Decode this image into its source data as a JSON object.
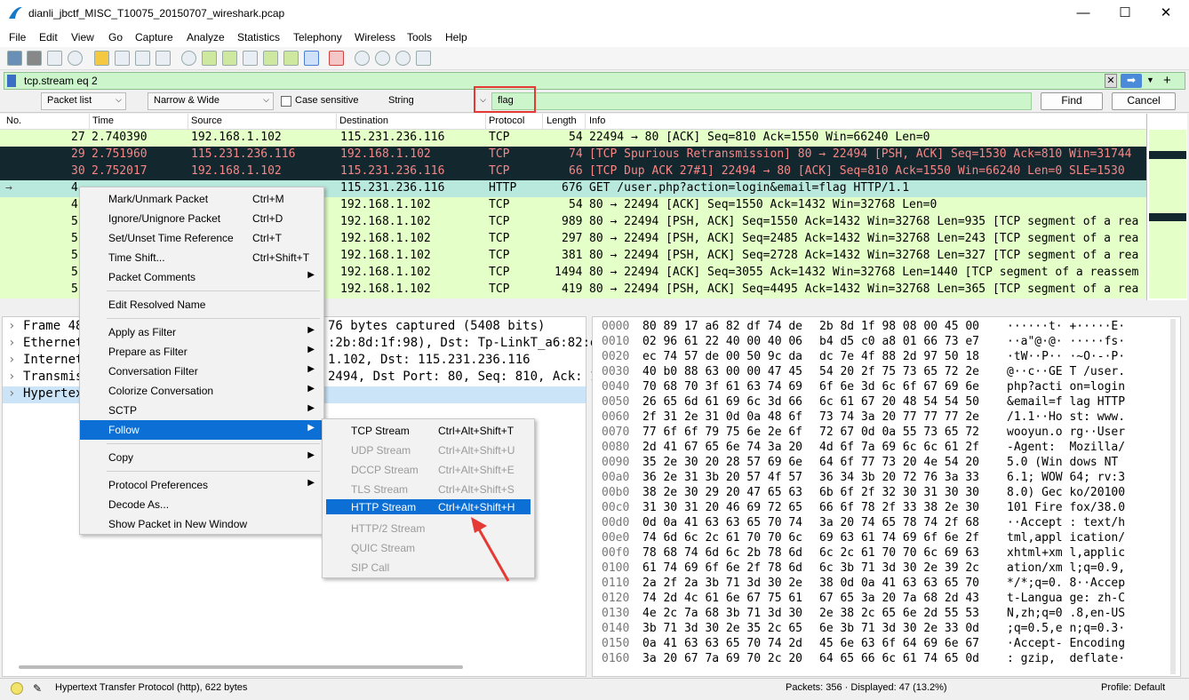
{
  "window": {
    "title": "dianli_jbctf_MISC_T10075_20150707_wireshark.pcap",
    "minimize": "—",
    "maximize": "☐",
    "close": "✕"
  },
  "menubar": [
    "File",
    "Edit",
    "View",
    "Go",
    "Capture",
    "Analyze",
    "Statistics",
    "Telephony",
    "Wireless",
    "Tools",
    "Help"
  ],
  "filter": {
    "value": "tcp.stream eq 2"
  },
  "findbar": {
    "scope": "Packet list",
    "charset": "Narrow & Wide",
    "case_label": "Case sensitive",
    "type": "String",
    "query": "flag",
    "find_label": "Find",
    "cancel_label": "Cancel"
  },
  "columns": [
    "No.",
    "Time",
    "Source",
    "Destination",
    "Protocol",
    "Length",
    "Info"
  ],
  "packets": [
    {
      "no": "27",
      "time": "2.740390",
      "src": "192.168.1.102",
      "dst": "115.231.236.116",
      "proto": "TCP",
      "len": "54",
      "info": "22494 → 80 [ACK] Seq=810 Ack=1550 Win=66240 Len=0"
    },
    {
      "no": "29",
      "time": "2.751960",
      "src": "115.231.236.116",
      "dst": "192.168.1.102",
      "proto": "TCP",
      "len": "74",
      "info": "[TCP Spurious Retransmission] 80 → 22494 [PSH, ACK] Seq=1530 Ack=810 Win=31744"
    },
    {
      "no": "30",
      "time": "2.752017",
      "src": "192.168.1.102",
      "dst": "115.231.236.116",
      "proto": "TCP",
      "len": "66",
      "info": "[TCP Dup ACK 27#1] 22494 → 80 [ACK] Seq=810 Ack=1550 Win=66240 Len=0 SLE=1530"
    },
    {
      "no": "4",
      "time": "",
      "src": "",
      "dst": "115.231.236.116",
      "proto": "HTTP",
      "len": "676",
      "info": "GET /user.php?action=login&email=flag HTTP/1.1"
    },
    {
      "no": "4",
      "time": "",
      "src": "",
      "dst": "192.168.1.102",
      "proto": "TCP",
      "len": "54",
      "info": "80 → 22494 [ACK] Seq=1550 Ack=1432 Win=32768 Len=0"
    },
    {
      "no": "5",
      "time": "",
      "src": "",
      "dst": "192.168.1.102",
      "proto": "TCP",
      "len": "989",
      "info": "80 → 22494 [PSH, ACK] Seq=1550 Ack=1432 Win=32768 Len=935 [TCP segment of a rea"
    },
    {
      "no": "5",
      "time": "",
      "src": "",
      "dst": "192.168.1.102",
      "proto": "TCP",
      "len": "297",
      "info": "80 → 22494 [PSH, ACK] Seq=2485 Ack=1432 Win=32768 Len=243 [TCP segment of a rea"
    },
    {
      "no": "5",
      "time": "",
      "src": "",
      "dst": "192.168.1.102",
      "proto": "TCP",
      "len": "381",
      "info": "80 → 22494 [PSH, ACK] Seq=2728 Ack=1432 Win=32768 Len=327 [TCP segment of a rea"
    },
    {
      "no": "5",
      "time": "",
      "src": "",
      "dst": "192.168.1.102",
      "proto": "TCP",
      "len": "1494",
      "info": "80 → 22494 [ACK] Seq=3055 Ack=1432 Win=32768 Len=1440 [TCP segment of a reassem"
    },
    {
      "no": "5",
      "time": "",
      "src": "",
      "dst": "192.168.1.102",
      "proto": "TCP",
      "len": "419",
      "info": "80 → 22494 [PSH, ACK] Seq=4495 Ack=1432 Win=32768 Len=365 [TCP segment of a rea"
    }
  ],
  "details": [
    {
      "head": "Frame 48",
      "tail": "76 bytes captured (5408 bits)"
    },
    {
      "head": "Ethernet",
      "tail": ":2b:8d:1f:98), Dst: Tp-LinkT_a6:82:df"
    },
    {
      "head": "Internet",
      "tail": "1.102, Dst: 115.231.236.116"
    },
    {
      "head": "Transmis",
      "tail": "2494, Dst Port: 80, Seq: 810, Ack: 15"
    },
    {
      "head": "Hypertex",
      "tail": ""
    }
  ],
  "hex": [
    {
      "off": "0000",
      "a": "80 89 17 a6 82 df 74 de",
      "b": "2b 8d 1f 98 08 00 45 00",
      "ascii": "······t· +·····E·"
    },
    {
      "off": "0010",
      "a": "02 96 61 22 40 00 40 06",
      "b": "b4 d5 c0 a8 01 66 73 e7",
      "ascii": "··a\"@·@· ·····fs·"
    },
    {
      "off": "0020",
      "a": "ec 74 57 de 00 50 9c da",
      "b": "dc 7e 4f 88 2d 97 50 18",
      "ascii": "·tW··P·· ·~O·-·P·"
    },
    {
      "off": "0030",
      "a": "40 b0 88 63 00 00 47 45",
      "b": "54 20 2f 75 73 65 72 2e",
      "ascii": "@··c··GE T /user."
    },
    {
      "off": "0040",
      "a": "70 68 70 3f 61 63 74 69",
      "b": "6f 6e 3d 6c 6f 67 69 6e",
      "ascii": "php?acti on=login"
    },
    {
      "off": "0050",
      "a": "26 65 6d 61 69 6c 3d 66",
      "b": "6c 61 67 20 48 54 54 50",
      "ascii": "&email=f lag HTTP"
    },
    {
      "off": "0060",
      "a": "2f 31 2e 31 0d 0a 48 6f",
      "b": "73 74 3a 20 77 77 77 2e",
      "ascii": "/1.1··Ho st: www."
    },
    {
      "off": "0070",
      "a": "77 6f 6f 79 75 6e 2e 6f",
      "b": "72 67 0d 0a 55 73 65 72",
      "ascii": "wooyun.o rg··User"
    },
    {
      "off": "0080",
      "a": "2d 41 67 65 6e 74 3a 20",
      "b": "4d 6f 7a 69 6c 6c 61 2f",
      "ascii": "-Agent:  Mozilla/"
    },
    {
      "off": "0090",
      "a": "35 2e 30 20 28 57 69 6e",
      "b": "64 6f 77 73 20 4e 54 20",
      "ascii": "5.0 (Win dows NT "
    },
    {
      "off": "00a0",
      "a": "36 2e 31 3b 20 57 4f 57",
      "b": "36 34 3b 20 72 76 3a 33",
      "ascii": "6.1; WOW 64; rv:3"
    },
    {
      "off": "00b0",
      "a": "38 2e 30 29 20 47 65 63",
      "b": "6b 6f 2f 32 30 31 30 30",
      "ascii": "8.0) Gec ko/20100"
    },
    {
      "off": "00c0",
      "a": "31 30 31 20 46 69 72 65",
      "b": "66 6f 78 2f 33 38 2e 30",
      "ascii": "101 Fire fox/38.0"
    },
    {
      "off": "00d0",
      "a": "0d 0a 41 63 63 65 70 74",
      "b": "3a 20 74 65 78 74 2f 68",
      "ascii": "··Accept : text/h"
    },
    {
      "off": "00e0",
      "a": "74 6d 6c 2c 61 70 70 6c",
      "b": "69 63 61 74 69 6f 6e 2f",
      "ascii": "tml,appl ication/"
    },
    {
      "off": "00f0",
      "a": "78 68 74 6d 6c 2b 78 6d",
      "b": "6c 2c 61 70 70 6c 69 63",
      "ascii": "xhtml+xm l,applic"
    },
    {
      "off": "0100",
      "a": "61 74 69 6f 6e 2f 78 6d",
      "b": "6c 3b 71 3d 30 2e 39 2c",
      "ascii": "ation/xm l;q=0.9,"
    },
    {
      "off": "0110",
      "a": "2a 2f 2a 3b 71 3d 30 2e",
      "b": "38 0d 0a 41 63 63 65 70",
      "ascii": "*/*;q=0. 8··Accep"
    },
    {
      "off": "0120",
      "a": "74 2d 4c 61 6e 67 75 61",
      "b": "67 65 3a 20 7a 68 2d 43",
      "ascii": "t-Langua ge: zh-C"
    },
    {
      "off": "0130",
      "a": "4e 2c 7a 68 3b 71 3d 30",
      "b": "2e 38 2c 65 6e 2d 55 53",
      "ascii": "N,zh;q=0 .8,en-US"
    },
    {
      "off": "0140",
      "a": "3b 71 3d 30 2e 35 2c 65",
      "b": "6e 3b 71 3d 30 2e 33 0d",
      "ascii": ";q=0.5,e n;q=0.3·"
    },
    {
      "off": "0150",
      "a": "0a 41 63 63 65 70 74 2d",
      "b": "45 6e 63 6f 64 69 6e 67",
      "ascii": "·Accept- Encoding"
    },
    {
      "off": "0160",
      "a": "3a 20 67 7a 69 70 2c 20",
      "b": "64 65 66 6c 61 74 65 0d",
      "ascii": ": gzip,  deflate·"
    }
  ],
  "context_menu": [
    {
      "label": "Mark/Unmark Packet",
      "shortcut": "Ctrl+M"
    },
    {
      "label": "Ignore/Unignore Packet",
      "shortcut": "Ctrl+D"
    },
    {
      "label": "Set/Unset Time Reference",
      "shortcut": "Ctrl+T"
    },
    {
      "label": "Time Shift...",
      "shortcut": "Ctrl+Shift+T"
    },
    {
      "label": "Packet Comments",
      "shortcut": ""
    },
    {
      "label": "Edit Resolved Name",
      "shortcut": ""
    },
    {
      "label": "Apply as Filter",
      "shortcut": ""
    },
    {
      "label": "Prepare as Filter",
      "shortcut": ""
    },
    {
      "label": "Conversation Filter",
      "shortcut": ""
    },
    {
      "label": "Colorize Conversation",
      "shortcut": ""
    },
    {
      "label": "SCTP",
      "shortcut": ""
    },
    {
      "label": "Follow",
      "shortcut": ""
    },
    {
      "label": "Copy",
      "shortcut": ""
    },
    {
      "label": "Protocol Preferences",
      "shortcut": ""
    },
    {
      "label": "Decode As...",
      "shortcut": ""
    },
    {
      "label": "Show Packet in New Window",
      "shortcut": ""
    }
  ],
  "follow_menu": [
    {
      "label": "TCP Stream",
      "shortcut": "Ctrl+Alt+Shift+T"
    },
    {
      "label": "UDP Stream",
      "shortcut": "Ctrl+Alt+Shift+U"
    },
    {
      "label": "DCCP Stream",
      "shortcut": "Ctrl+Alt+Shift+E"
    },
    {
      "label": "TLS Stream",
      "shortcut": "Ctrl+Alt+Shift+S"
    },
    {
      "label": "HTTP Stream",
      "shortcut": "Ctrl+Alt+Shift+H"
    },
    {
      "label": "HTTP/2 Stream",
      "shortcut": ""
    },
    {
      "label": "QUIC Stream",
      "shortcut": ""
    },
    {
      "label": "SIP Call",
      "shortcut": ""
    }
  ],
  "status": {
    "protocol": "Hypertext Transfer Protocol (http), 622 bytes",
    "packets": "Packets: 356 · Displayed: 47 (13.2%)",
    "profile": "Profile: Default"
  },
  "colors": {
    "tcp_row": "#e4ffc7",
    "bad_row": "#12272e",
    "http_row": "#b9e8dd",
    "selection": "#0b6fd6",
    "annotation": "#e53935"
  }
}
